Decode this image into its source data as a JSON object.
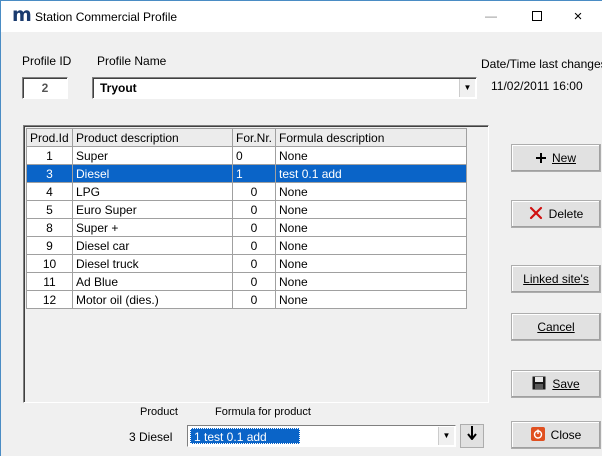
{
  "window": {
    "app_icon": "m",
    "title": "Station Commercial Profile",
    "minimize": "—",
    "close": "×"
  },
  "profile": {
    "id_label": "Profile ID",
    "id_value": "2",
    "name_label": "Profile Name",
    "name_value": "Tryout",
    "date_label": "Date/Time last changes",
    "date_value": "11/02/2011  16:00"
  },
  "table": {
    "headers": [
      "Prod.Id",
      "Product description",
      "For.Nr.",
      "Formula description"
    ],
    "rows": [
      {
        "id": "1",
        "desc": "Super",
        "for": "0",
        "formula": "None"
      },
      {
        "id": "3",
        "desc": "Diesel",
        "for": "1",
        "formula": "test 0.1 add"
      },
      {
        "id": "4",
        "desc": "LPG",
        "for": "0",
        "formula": "None"
      },
      {
        "id": "5",
        "desc": "Euro Super",
        "for": "0",
        "formula": "None"
      },
      {
        "id": "8",
        "desc": "Super +",
        "for": "0",
        "formula": "None"
      },
      {
        "id": "9",
        "desc": "Diesel car",
        "for": "0",
        "formula": "None"
      },
      {
        "id": "10",
        "desc": "Diesel truck",
        "for": "0",
        "formula": "None"
      },
      {
        "id": "11",
        "desc": "Ad Blue",
        "for": "0",
        "formula": "None"
      },
      {
        "id": "12",
        "desc": "Motor oil (dies.)",
        "for": "0",
        "formula": "None"
      }
    ],
    "selected_index": 1
  },
  "buttons": {
    "new": "New",
    "delete": "Delete",
    "linked": "Linked site's",
    "cancel": "Cancel",
    "save": "Save",
    "close": "Close"
  },
  "bottom": {
    "product_label": "Product",
    "formula_label": "Formula for product",
    "product_value": "3 Diesel",
    "formula_value": "1  test 0.1 add"
  },
  "icons": {
    "app": "app-logo-icon",
    "new": "plus-icon",
    "delete": "red-x-icon",
    "save": "floppy-disk-icon",
    "close": "power-icon",
    "dropdown": "chevron-down-icon",
    "apply": "down-arrow-icon"
  },
  "colors": {
    "selection": "#0a64c8",
    "delete_icon": "#d01010",
    "close_icon": "#e05020"
  }
}
